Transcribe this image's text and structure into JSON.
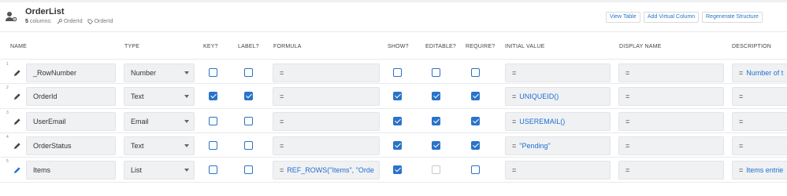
{
  "header": {
    "table_name": "OrderList",
    "column_count_num": "5",
    "column_count_label": "columns:",
    "key_tag": "OrderId",
    "label_tag": "OrderId",
    "buttons": {
      "view_table": "View Table",
      "add_virtual_column": "Add Virtual Column",
      "regenerate_structure": "Regenerate Structure"
    }
  },
  "columns": {
    "name": "NAME",
    "type": "TYPE",
    "key": "KEY?",
    "label": "LABEL?",
    "formula": "FORMULA",
    "show": "SHOW?",
    "editable": "EDITABLE?",
    "require": "REQUIRE?",
    "initial_value": "INITIAL VALUE",
    "display_name": "DISPLAY NAME",
    "description": "DESCRIPTION"
  },
  "rows": [
    {
      "num": "1",
      "name": "_RowNumber",
      "type": "Number",
      "key": false,
      "label": false,
      "formula_eq": "=",
      "formula_expr": "",
      "show": false,
      "editable": false,
      "editable_disabled": false,
      "require": false,
      "initial_eq": "=",
      "initial_expr": "",
      "display_eq": "=",
      "desc_eq": "=",
      "desc_expr": "Number of t"
    },
    {
      "num": "2",
      "name": "OrderId",
      "type": "Text",
      "key": true,
      "label": true,
      "formula_eq": "=",
      "formula_expr": "",
      "show": true,
      "editable": true,
      "editable_disabled": false,
      "require": true,
      "initial_eq": "=",
      "initial_expr": "UNIQUEID()",
      "display_eq": "=",
      "desc_eq": "=",
      "desc_expr": ""
    },
    {
      "num": "3",
      "name": "UserEmail",
      "type": "Email",
      "key": false,
      "label": false,
      "formula_eq": "=",
      "formula_expr": "",
      "show": true,
      "editable": true,
      "editable_disabled": false,
      "require": true,
      "initial_eq": "=",
      "initial_expr": "USEREMAIL()",
      "display_eq": "=",
      "desc_eq": "=",
      "desc_expr": ""
    },
    {
      "num": "4",
      "name": "OrderStatus",
      "type": "Text",
      "key": false,
      "label": false,
      "formula_eq": "=",
      "formula_expr": "",
      "show": true,
      "editable": true,
      "editable_disabled": false,
      "require": true,
      "initial_eq": "=",
      "initial_expr": "\"Pending\"",
      "display_eq": "=",
      "desc_eq": "=",
      "desc_expr": ""
    },
    {
      "num": "5",
      "name": "Items",
      "type": "List",
      "key": false,
      "label": false,
      "formula_eq": "=",
      "formula_expr": "REF_ROWS(\"Items\", \"Orde",
      "show": true,
      "editable": false,
      "editable_disabled": true,
      "require": false,
      "initial_eq": "=",
      "initial_expr": "",
      "display_eq": "=",
      "desc_eq": "=",
      "desc_expr": "Items entrie"
    }
  ],
  "colors": {
    "accent": "#2a73c9",
    "expr": "#1f6fd0",
    "field_bg": "#f0f1f3"
  }
}
